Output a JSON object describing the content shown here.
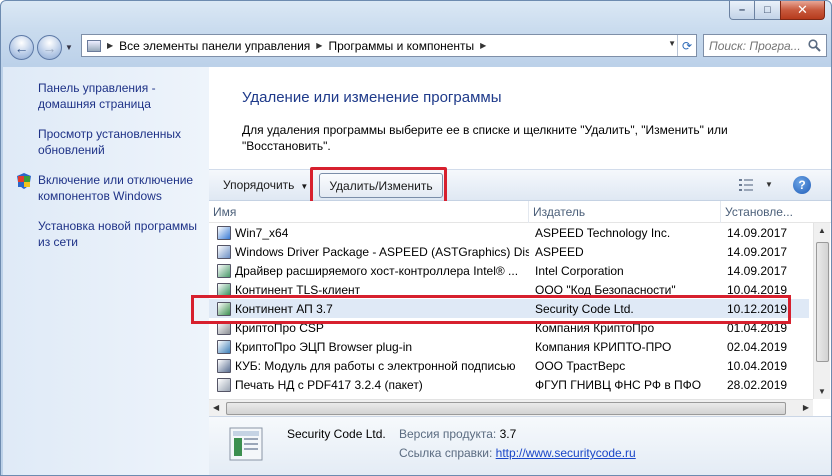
{
  "window": {
    "close_glyph": "✕",
    "maximize_glyph": "□",
    "minimize_glyph": "–"
  },
  "navigation": {
    "back_glyph": "←",
    "forward_glyph": "→",
    "breadcrumb": [
      "Все элементы панели управления",
      "Программы и компоненты"
    ],
    "search_placeholder": "Поиск: Програ..."
  },
  "sidebar": {
    "items": [
      {
        "label": "Панель управления - домашняя страница"
      },
      {
        "label": "Просмотр установленных обновлений"
      },
      {
        "label": "Включение или отключение компонентов Windows",
        "icon": "shield-icon"
      },
      {
        "label": "Установка новой программы из сети"
      }
    ]
  },
  "main": {
    "title": "Удаление или изменение программы",
    "description": "Для удаления программы выберите ее в списке и щелкните \"Удалить\", \"Изменить\" или \"Восстановить\"."
  },
  "toolbar": {
    "organize_label": "Упорядочить",
    "uninstall_label": "Удалить/Изменить",
    "help_glyph": "?"
  },
  "list": {
    "columns": [
      "Имя",
      "Издатель",
      "Установле..."
    ],
    "rows": [
      {
        "name": "Win7_x64",
        "publisher": "ASPEED Technology Inc.",
        "date": "14.09.2017",
        "icon_color": "#3a7bd5"
      },
      {
        "name": "Windows Driver Package - ASPEED (ASTGraphics) Dis...",
        "publisher": "ASPEED",
        "date": "14.09.2017",
        "icon_color": "#6b8fc4"
      },
      {
        "name": "Драйвер расширяемого хост-контроллера Intel® ...",
        "publisher": "Intel Corporation",
        "date": "14.09.2017",
        "icon_color": "#4a9a6a"
      },
      {
        "name": "Континент TLS-клиент",
        "publisher": "ООО \"Код Безопасности\"",
        "date": "10.04.2019",
        "icon_color": "#2f8f5a"
      },
      {
        "name": "Континент АП 3.7",
        "publisher": "Security Code Ltd.",
        "date": "10.12.2019",
        "icon_color": "#3c8f4f",
        "selected": true
      },
      {
        "name": "КриптоПро CSP",
        "publisher": "Компания КриптоПро",
        "date": "01.04.2019",
        "icon_color": "#8c8f95"
      },
      {
        "name": "КриптоПро ЭЦП Browser plug-in",
        "publisher": "Компания КРИПТО-ПРО",
        "date": "02.04.2019",
        "icon_color": "#3d7fb8"
      },
      {
        "name": "КУБ: Модуль для работы с электронной подписью",
        "publisher": "ООО ТрастВерс",
        "date": "10.04.2019",
        "icon_color": "#5a6f92"
      },
      {
        "name": "Печать НД с PDF417 3.2.4 (пакет)",
        "publisher": "ФГУП ГНИВЦ ФНС РФ в ПФО",
        "date": "28.02.2019",
        "icon_color": "#9aa4b3"
      }
    ]
  },
  "details": {
    "publisher": "Security Code Ltd.",
    "version_label": "Версия продукта:",
    "version": "3.7",
    "support_label": "Ссылка справки:",
    "support_url": "http://www.securitycode.ru"
  },
  "colors": {
    "highlight": "#d7202e",
    "link": "#1e3287",
    "title": "#1e3a8a"
  }
}
